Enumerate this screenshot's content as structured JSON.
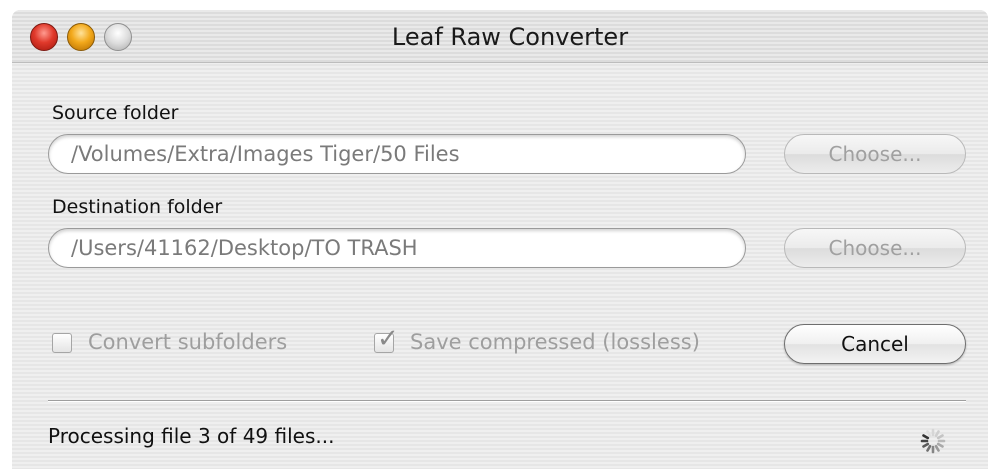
{
  "window": {
    "title": "Leaf Raw Converter",
    "controls": [
      "close",
      "minimize",
      "zoom"
    ]
  },
  "source": {
    "label": "Source folder",
    "path": "/Volumes/Extra/Images Tiger/50 Files",
    "choose_label": "Choose..."
  },
  "destination": {
    "label": "Destination folder",
    "path": "/Users/41162/Desktop/TO TRASH",
    "choose_label": "Choose..."
  },
  "options": {
    "convert_subfolders": {
      "label": "Convert subfolders",
      "checked": false,
      "enabled": false
    },
    "save_compressed": {
      "label": "Save compressed (lossless)",
      "checked": true,
      "enabled": false
    }
  },
  "actions": {
    "cancel_label": "Cancel"
  },
  "status": {
    "text": "Processing file 3 of 49 files..."
  },
  "icons": {
    "close": "close-icon",
    "minimize": "minimize-icon",
    "zoom": "zoom-icon",
    "check": "checkmark-icon",
    "spinner": "spinner-icon"
  },
  "colors": {
    "close": "#e0392b",
    "minimize": "#f2a81a",
    "zoom": "#dcdcdc",
    "disabled_text": "#9e9e9e"
  }
}
